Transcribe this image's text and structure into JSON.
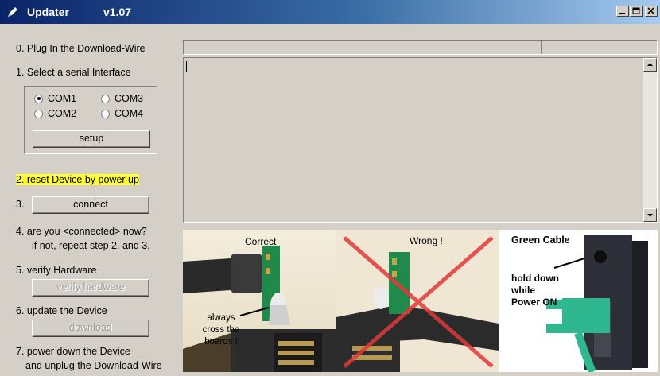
{
  "window": {
    "title": "Updater",
    "version": "v1.07"
  },
  "steps": {
    "step0": "0. Plug In the Download-Wire",
    "step1": "1. Select a serial Interface",
    "step2": "2. reset Device by power up",
    "step3": "3.",
    "step4_line1": "4. are you  <connected> now?",
    "step4_line2": "if not, repeat step 2. and 3.",
    "step5": "5. verify Hardware",
    "step6": "6. update the Device",
    "step7_line1": "7. power down the Device",
    "step7_line2": "and unplug the Download-Wire"
  },
  "ports": [
    {
      "label": "COM1",
      "selected": true
    },
    {
      "label": "COM3",
      "selected": false
    },
    {
      "label": "COM2",
      "selected": false
    },
    {
      "label": "COM4",
      "selected": false
    }
  ],
  "buttons": {
    "setup": "setup",
    "connect": "connect",
    "verify": "verify hardware",
    "download": "download"
  },
  "images": {
    "correct": {
      "caption": "Correct",
      "note_line1": "always",
      "note_line2": "cross the",
      "note_line3": "boards !"
    },
    "wrong": {
      "caption": "Wrong !"
    },
    "green": {
      "caption": "Green Cable",
      "note_line1": "hold down",
      "note_line2": "while",
      "note_line3": "Power ON"
    }
  },
  "colors": {
    "highlight": "#ffff33",
    "title_start": "#0a246a",
    "title_end": "#a6caf0",
    "cable_green": "#2fb890",
    "cross_red": "#e03a3a"
  }
}
